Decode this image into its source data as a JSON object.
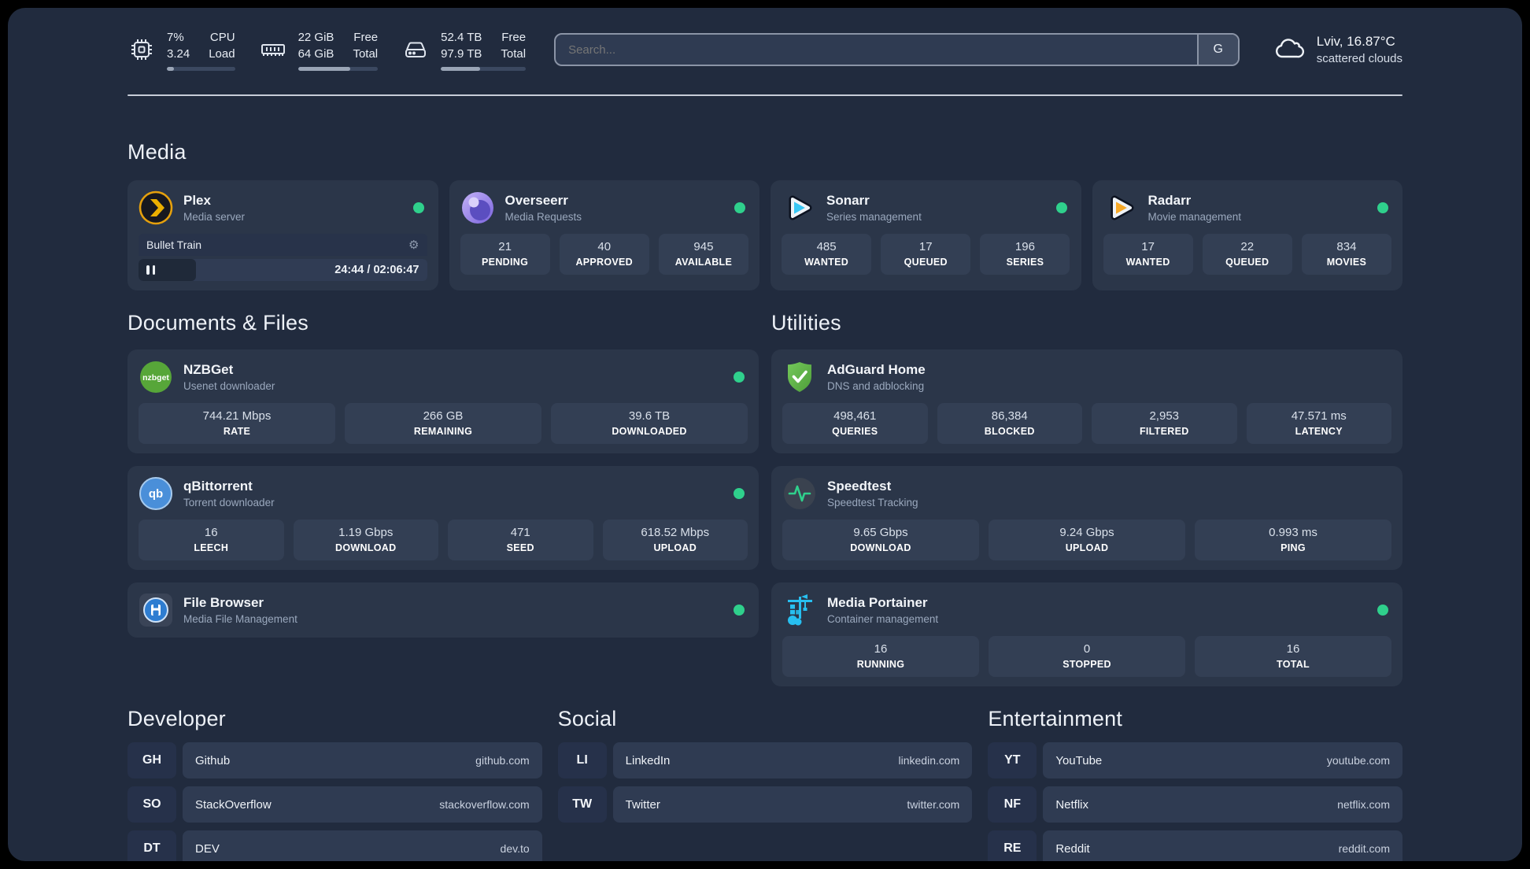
{
  "topbar": {
    "stats": [
      {
        "icon": "cpu-icon",
        "values": [
          "7%",
          "3.24"
        ],
        "labels": [
          "CPU",
          "Load"
        ],
        "progress": 10
      },
      {
        "icon": "ram-icon",
        "values": [
          "22 GiB",
          "64 GiB"
        ],
        "labels": [
          "Free",
          "Total"
        ],
        "progress": 65
      },
      {
        "icon": "disk-icon",
        "values": [
          "52.4 TB",
          "97.9 TB"
        ],
        "labels": [
          "Free",
          "Total"
        ],
        "progress": 46
      }
    ],
    "search": {
      "placeholder": "Search...",
      "button_label": "G"
    },
    "weather": {
      "location": "Lviv, 16.87°C",
      "condition": "scattered clouds"
    }
  },
  "media": {
    "title": "Media",
    "plex": {
      "title": "Plex",
      "subtitle": "Media server",
      "online": true,
      "stream": {
        "name": "Bullet Train",
        "time_display": "24:44 / 02:06:47",
        "progress_pct": 20
      }
    },
    "overseerr": {
      "title": "Overseerr",
      "subtitle": "Media Requests",
      "online": true,
      "stats": [
        {
          "value": "21",
          "label": "PENDING"
        },
        {
          "value": "40",
          "label": "APPROVED"
        },
        {
          "value": "945",
          "label": "AVAILABLE"
        }
      ]
    },
    "sonarr": {
      "title": "Sonarr",
      "subtitle": "Series management",
      "online": true,
      "stats": [
        {
          "value": "485",
          "label": "WANTED"
        },
        {
          "value": "17",
          "label": "QUEUED"
        },
        {
          "value": "196",
          "label": "SERIES"
        }
      ]
    },
    "radarr": {
      "title": "Radarr",
      "subtitle": "Movie management",
      "online": true,
      "stats": [
        {
          "value": "17",
          "label": "WANTED"
        },
        {
          "value": "22",
          "label": "QUEUED"
        },
        {
          "value": "834",
          "label": "MOVIES"
        }
      ]
    }
  },
  "documents": {
    "title": "Documents & Files",
    "nzbget": {
      "title": "NZBGet",
      "subtitle": "Usenet downloader",
      "online": true,
      "stats": [
        {
          "value": "744.21 Mbps",
          "label": "RATE"
        },
        {
          "value": "266 GB",
          "label": "REMAINING"
        },
        {
          "value": "39.6 TB",
          "label": "DOWNLOADED"
        }
      ]
    },
    "qbittorrent": {
      "title": "qBittorrent",
      "subtitle": "Torrent downloader",
      "online": true,
      "stats": [
        {
          "value": "16",
          "label": "LEECH"
        },
        {
          "value": "1.19 Gbps",
          "label": "DOWNLOAD"
        },
        {
          "value": "471",
          "label": "SEED"
        },
        {
          "value": "618.52 Mbps",
          "label": "UPLOAD"
        }
      ]
    },
    "filebrowser": {
      "title": "File Browser",
      "subtitle": "Media File Management",
      "online": true
    }
  },
  "utilities": {
    "title": "Utilities",
    "adguard": {
      "title": "AdGuard Home",
      "subtitle": "DNS and adblocking",
      "stats": [
        {
          "value": "498,461",
          "label": "QUERIES"
        },
        {
          "value": "86,384",
          "label": "BLOCKED"
        },
        {
          "value": "2,953",
          "label": "FILTERED"
        },
        {
          "value": "47.571 ms",
          "label": "LATENCY"
        }
      ]
    },
    "speedtest": {
      "title": "Speedtest",
      "subtitle": "Speedtest Tracking",
      "stats": [
        {
          "value": "9.65 Gbps",
          "label": "DOWNLOAD"
        },
        {
          "value": "9.24 Gbps",
          "label": "UPLOAD"
        },
        {
          "value": "0.993 ms",
          "label": "PING"
        }
      ]
    },
    "portainer": {
      "title": "Media Portainer",
      "subtitle": "Container management",
      "online": true,
      "stats": [
        {
          "value": "16",
          "label": "RUNNING"
        },
        {
          "value": "0",
          "label": "STOPPED"
        },
        {
          "value": "16",
          "label": "TOTAL"
        }
      ]
    }
  },
  "links": {
    "developer": {
      "title": "Developer",
      "items": [
        {
          "abbr": "GH",
          "name": "Github",
          "url": "github.com"
        },
        {
          "abbr": "SO",
          "name": "StackOverflow",
          "url": "stackoverflow.com"
        },
        {
          "abbr": "DT",
          "name": "DEV",
          "url": "dev.to"
        }
      ]
    },
    "social": {
      "title": "Social",
      "items": [
        {
          "abbr": "LI",
          "name": "LinkedIn",
          "url": "linkedin.com"
        },
        {
          "abbr": "TW",
          "name": "Twitter",
          "url": "twitter.com"
        }
      ]
    },
    "entertainment": {
      "title": "Entertainment",
      "items": [
        {
          "abbr": "YT",
          "name": "YouTube",
          "url": "youtube.com"
        },
        {
          "abbr": "NF",
          "name": "Netflix",
          "url": "netflix.com"
        },
        {
          "abbr": "RE",
          "name": "Reddit",
          "url": "reddit.com"
        }
      ]
    }
  },
  "colors": {
    "background": "#212b3e",
    "card": "#2b3649",
    "stat_box": "#333f54",
    "accent_green": "#2fd08c"
  }
}
